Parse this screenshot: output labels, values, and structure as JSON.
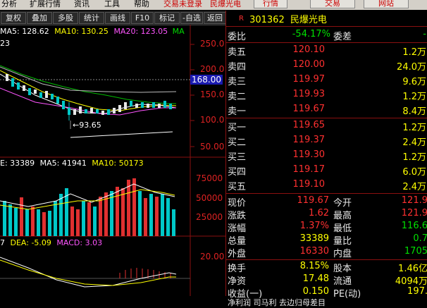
{
  "menu": {
    "items": [
      "分析",
      "扩展行情",
      "资讯",
      "工具",
      "帮助"
    ],
    "status": "交易未登录",
    "stock_title": "民爆光电",
    "buttons": [
      "行情",
      "交易",
      "网站"
    ]
  },
  "toolbar": {
    "buttons": [
      "复权",
      "叠加",
      "多股",
      "统计",
      "画线",
      "F10",
      "标记",
      "-自选",
      "返回"
    ]
  },
  "price_chart": {
    "ma_legend": {
      "ma5": "MA5: 128.62",
      "ma10": "MA10: 130.25",
      "ma20": "MA20: 123.05",
      "more": "MA"
    },
    "left_tick": "23",
    "y_ticks": [
      "250.0",
      "200.0",
      "150.0",
      "100.0",
      "50.00"
    ],
    "cursor_price": "168.00",
    "low_annotation": "93.65"
  },
  "volume_chart": {
    "legend": {
      "vol": "E: 33389",
      "ma5": "MA5: 41941",
      "ma10": "MA10: 50173"
    },
    "y_ticks": [
      "75000",
      "50000",
      "25000"
    ]
  },
  "macd_chart": {
    "legend": {
      "dif": "7",
      "dea": "DEA: -5.09",
      "macd": "MACD: 3.03"
    },
    "y_tick": "20.00"
  },
  "quote": {
    "badge": "R",
    "code": "301362",
    "name": "民爆光电",
    "weibi": {
      "label": "委比",
      "value": "-54.17%"
    },
    "weicha": {
      "label": "委差",
      "value": "-"
    },
    "asks": [
      {
        "label": "卖五",
        "price": "120.10",
        "vol": "1.2万"
      },
      {
        "label": "卖四",
        "price": "120.00",
        "vol": "24.0万"
      },
      {
        "label": "卖三",
        "price": "119.97",
        "vol": "9.6万"
      },
      {
        "label": "卖二",
        "price": "119.93",
        "vol": "1.2万"
      },
      {
        "label": "卖一",
        "price": "119.67",
        "vol": "8.4万"
      }
    ],
    "bids": [
      {
        "label": "买一",
        "price": "119.65",
        "vol": "1.2万"
      },
      {
        "label": "买二",
        "price": "119.37",
        "vol": "2.4万"
      },
      {
        "label": "买三",
        "price": "119.30",
        "vol": "1.2万"
      },
      {
        "label": "买四",
        "price": "119.17",
        "vol": "6.0万"
      },
      {
        "label": "买五",
        "price": "119.10",
        "vol": "2.4万"
      }
    ],
    "stats": [
      {
        "l1": "现价",
        "v1": "119.67",
        "l2": "今开",
        "v2": "121.9"
      },
      {
        "l1": "涨跌",
        "v1": "1.62",
        "l2": "最高",
        "v2": "121.9"
      },
      {
        "l1": "涨幅",
        "v1": "1.37%",
        "l2": "最低",
        "v2": "116.6"
      },
      {
        "l1": "总量",
        "v1": "33389",
        "l2": "量比",
        "v2": "0.7"
      },
      {
        "l1": "外盘",
        "v1": "16330",
        "l2": "内盘",
        "v2": "1705"
      },
      {
        "l1": "换手",
        "v1": "8.15%",
        "l2": "股本",
        "v2": "1.46亿"
      },
      {
        "l1": "净资",
        "v1": "17.48",
        "l2": "流通",
        "v2": "4094万"
      },
      {
        "l1": "收益(一)",
        "v1": "0.150",
        "l2": "PE(动)",
        "v2": "197."
      }
    ],
    "footer": "净利润 司马利 去边归母差目"
  },
  "colors": {
    "up": "#ff3030",
    "down": "#00e000",
    "volume": "#ffff00",
    "panel_border": "#8a1010",
    "candle_up": "#e8e8e8",
    "candle_down": "#00c8c8"
  }
}
